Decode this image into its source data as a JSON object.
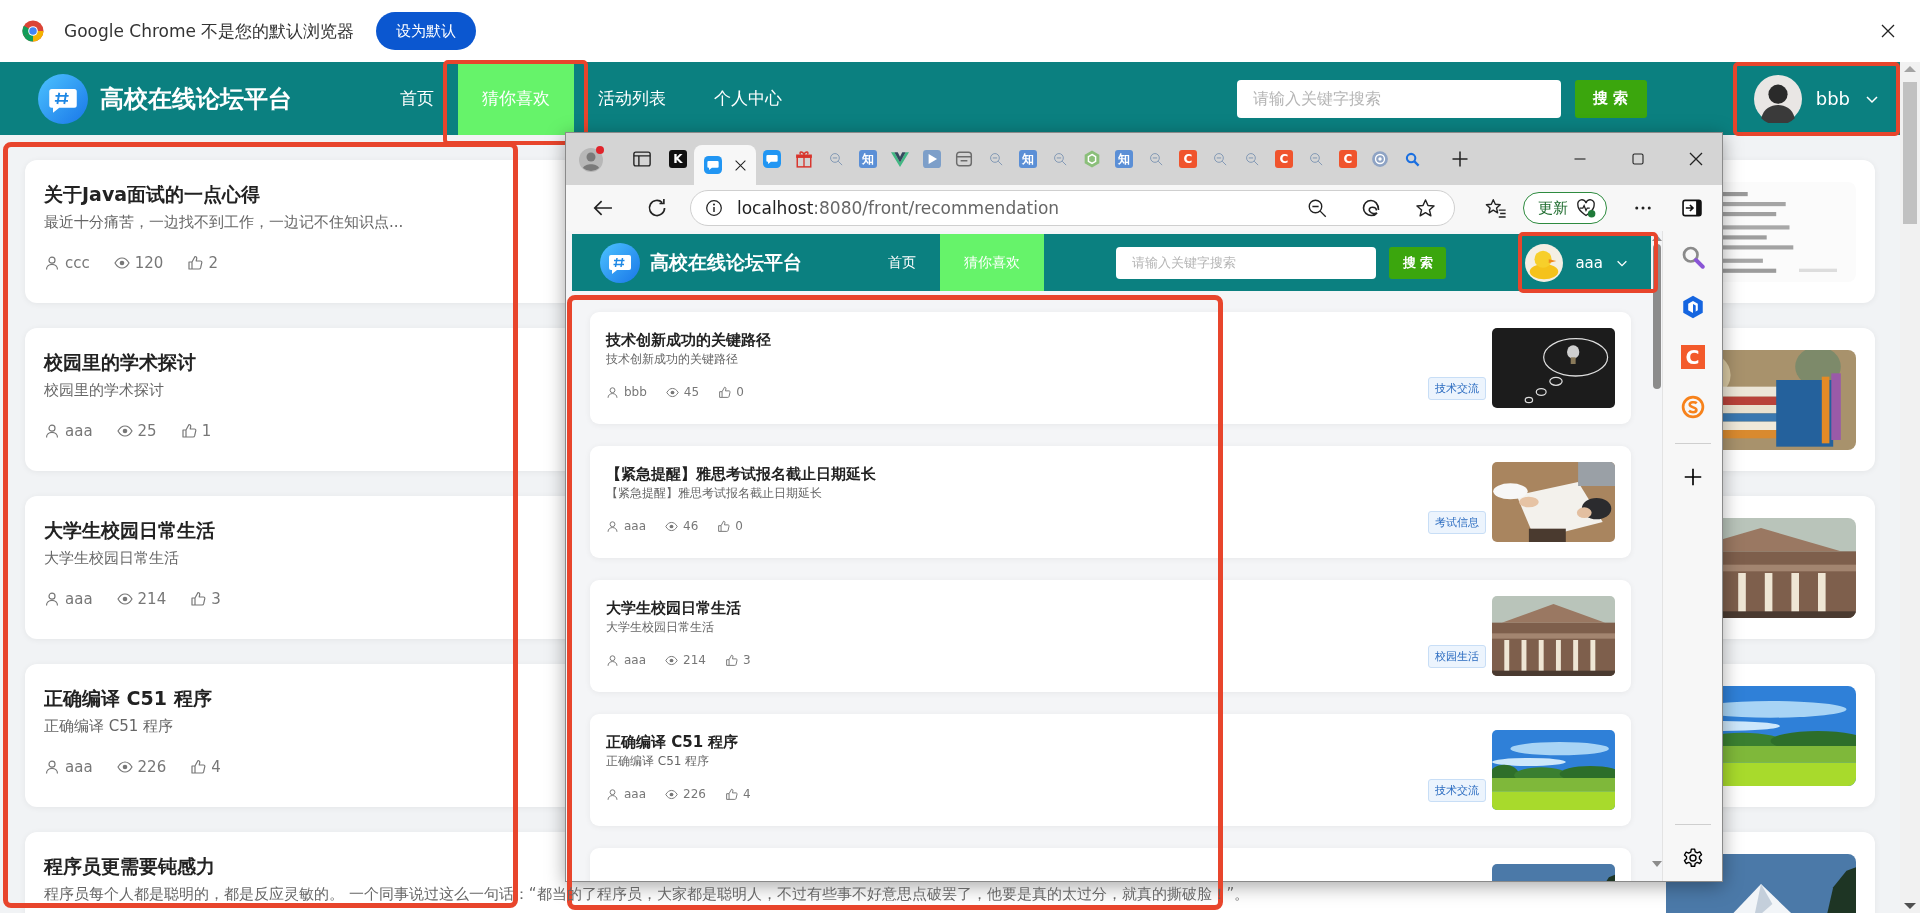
{
  "browser_banner": {
    "message": "Google Chrome 不是您的默认浏览器",
    "button": "设为默认"
  },
  "site": {
    "title": "高校在线论坛平台",
    "nav": [
      {
        "label": "首页",
        "selected": false
      },
      {
        "label": "猜你喜欢",
        "selected": true
      },
      {
        "label": "活动列表",
        "selected": false
      },
      {
        "label": "个人中心",
        "selected": false
      }
    ],
    "search": {
      "placeholder": "请输入关键字搜索",
      "button": "搜 索"
    },
    "user": {
      "name": "bbb"
    }
  },
  "posts": [
    {
      "title": "关于Java面试的一点心得",
      "summary": "最近十分痛苦，一边找不到工作，一边记不住知识点...",
      "author": "ccc",
      "views": "120",
      "likes": "2"
    },
    {
      "title": "校园里的学术探讨",
      "summary": "校园里的学术探讨",
      "author": "aaa",
      "views": "25",
      "likes": "1"
    },
    {
      "title": "大学生校园日常生活",
      "summary": "大学生校园日常生活",
      "author": "aaa",
      "views": "214",
      "likes": "3"
    },
    {
      "title": "正确编译 C51 程序",
      "summary": "正确编译 C51 程序",
      "author": "aaa",
      "views": "226",
      "likes": "4"
    },
    {
      "title": "程序员更需要钝感力",
      "summary": "程序员每个人都是聪明的，都是反应灵敏的。 一个同事说过这么一句话：“都当的了程序员，大家都是聪明人，不过有些事不好意思点破罢了，他要是真的太过分，就真的撕破脸！”。"
    }
  ],
  "edge_window": {
    "tabs": [
      {
        "kind": "letter",
        "glyph": "K",
        "color": "#111111",
        "selected": false
      },
      {
        "kind": "chat",
        "selected": true
      },
      {
        "kind": "chat",
        "selected": false
      },
      {
        "kind": "gift",
        "selected": false
      },
      {
        "kind": "search",
        "selected": false
      },
      {
        "kind": "letter",
        "glyph": "知",
        "color": "#5b8fd6",
        "selected": false
      },
      {
        "kind": "vue",
        "selected": false
      },
      {
        "kind": "play",
        "selected": false
      },
      {
        "kind": "box",
        "selected": false
      },
      {
        "kind": "search",
        "selected": false
      },
      {
        "kind": "letter",
        "glyph": "知",
        "color": "#5b8fd6",
        "selected": false
      },
      {
        "kind": "search",
        "selected": false
      },
      {
        "kind": "hex",
        "selected": false
      },
      {
        "kind": "letter",
        "glyph": "知",
        "color": "#5b8fd6",
        "selected": false
      },
      {
        "kind": "search",
        "selected": false
      },
      {
        "kind": "letter",
        "glyph": "C",
        "color": "#f0542d",
        "selected": false
      },
      {
        "kind": "search",
        "selected": false
      },
      {
        "kind": "search",
        "selected": false
      },
      {
        "kind": "letter",
        "glyph": "C",
        "color": "#f0542d",
        "selected": false
      },
      {
        "kind": "search",
        "selected": false
      },
      {
        "kind": "letter",
        "glyph": "C",
        "color": "#f0542d",
        "selected": false
      },
      {
        "kind": "globe",
        "selected": false
      },
      {
        "kind": "magnifier",
        "selected": false
      }
    ],
    "address": {
      "host": "localhost",
      "path": ":8080/front/recommendation"
    },
    "update_button": "更新",
    "sidebar": [
      {
        "kind": "search"
      },
      {
        "kind": "cube"
      },
      {
        "kind": "letter",
        "glyph": "C",
        "color": "#f35a2b"
      },
      {
        "kind": "sogou"
      }
    ],
    "page": {
      "title": "高校在线论坛平台",
      "nav": [
        {
          "label": "首页",
          "selected": false
        },
        {
          "label": "猜你喜欢",
          "selected": true
        }
      ],
      "search": {
        "placeholder": "请输入关键字搜索",
        "button": "搜 索"
      },
      "user": {
        "name": "aaa"
      },
      "posts": [
        {
          "title": "技术创新成功的关键路径",
          "summary": "技术创新成功的关键路径",
          "author": "bbb",
          "views": "45",
          "likes": "0",
          "tag": "技术交流"
        },
        {
          "title": "【紧急提醒】雅思考试报名截止日期延长",
          "summary": "【紧急提醒】雅思考试报名截止日期延长",
          "author": "aaa",
          "views": "46",
          "likes": "0",
          "tag": "考试信息"
        },
        {
          "title": "大学生校园日常生活",
          "summary": "大学生校园日常生活",
          "author": "aaa",
          "views": "214",
          "likes": "3",
          "tag": "校园生活"
        },
        {
          "title": "正确编译 C51 程序",
          "summary": "正确编译 C51 程序",
          "author": "aaa",
          "views": "226",
          "likes": "4",
          "tag": "技术交流"
        }
      ]
    }
  }
}
